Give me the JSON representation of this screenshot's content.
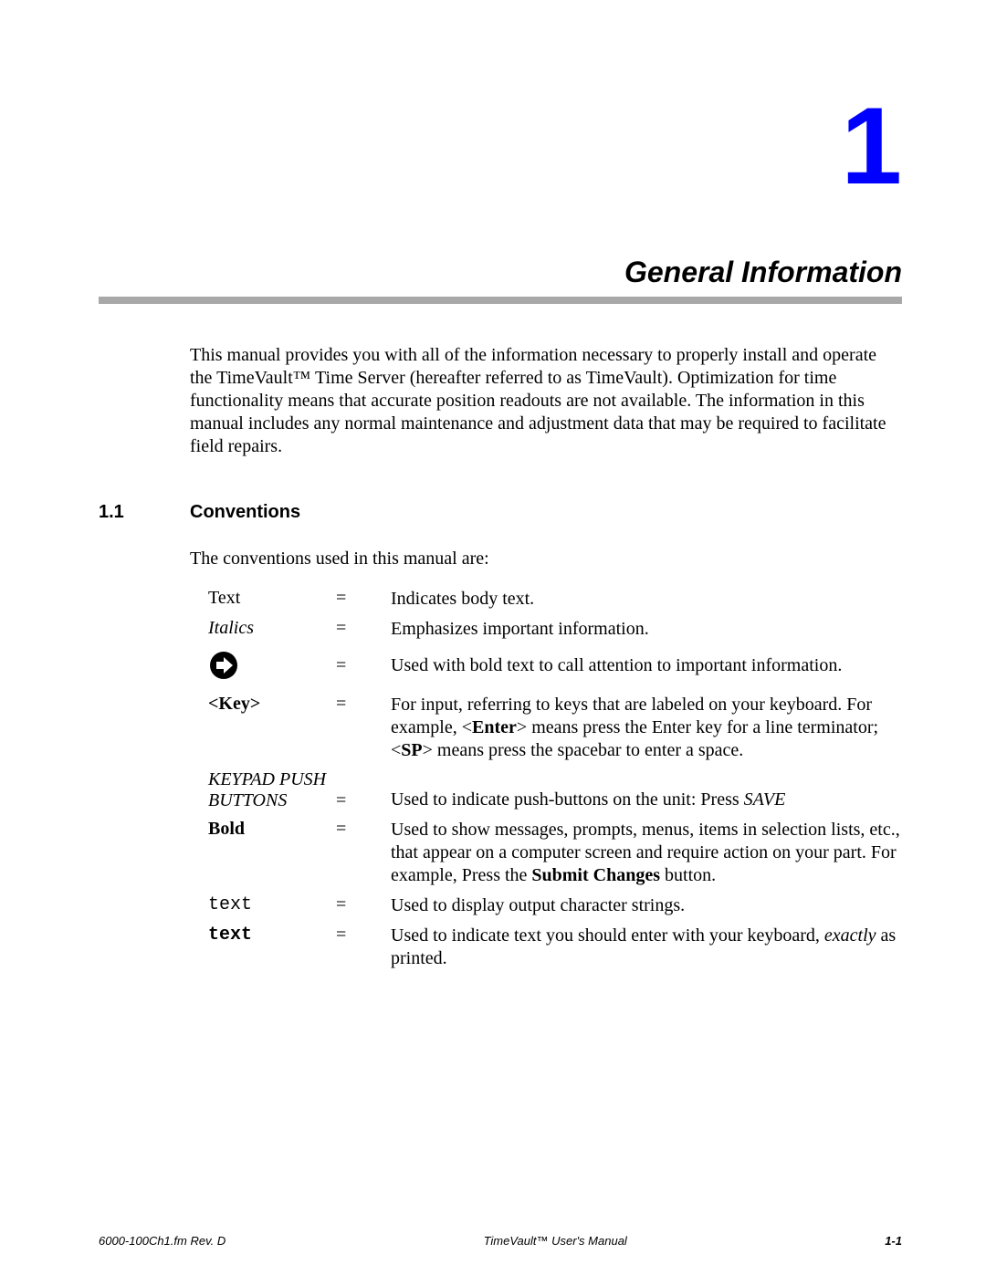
{
  "chapter": {
    "number": "1",
    "title": "General Information"
  },
  "intro": "This manual provides you with all of the information necessary to properly install and operate the TimeVault™ Time Server (hereafter referred to as TimeVault).  Optimization for time functionality means that accurate position readouts are not available.  The information in this manual includes any normal maintenance and adjustment data that may be required to facilitate field repairs.",
  "section": {
    "number": "1.1",
    "title": "Conventions",
    "lead": "The conventions used in this manual are:"
  },
  "conventions": {
    "r1": {
      "label": "Text",
      "eq": "=",
      "desc": "Indicates body text."
    },
    "r2": {
      "label": "Italics",
      "eq": "=",
      "desc": "Emphasizes important information."
    },
    "r3": {
      "eq": "=",
      "desc": "Used with bold text to call attention to important information."
    },
    "r4": {
      "label": "<Key>",
      "eq": "=",
      "d1": "For input, referring to keys that are labeled on your keyboard. For example, <",
      "d2": "Enter",
      "d3": "> means press the Enter key for a line terminator;  <",
      "d4": "SP",
      "d5": "> means press the spacebar to enter a space."
    },
    "r5": {
      "label1": "KEYPAD PUSH",
      "label2": "BUTTONS",
      "eq": "=",
      "d1": "Used to indicate push-buttons on the unit: Press ",
      "d2": "SAVE"
    },
    "r6": {
      "label": "Bold",
      "eq": "=",
      "d1": "Used to show messages, prompts, menus, items in selection lists, etc., that appear on a computer screen and require action on your part.  For example, Press the ",
      "d2": "Submit Changes",
      "d3": " button."
    },
    "r7": {
      "label": "text",
      "eq": "=",
      "desc": "Used to display output character strings."
    },
    "r8": {
      "label": "text",
      "eq": "=",
      "d1": "Used to indicate text you should enter with your keyboard, ",
      "d2": "exactly",
      "d3": " as printed."
    }
  },
  "footer": {
    "left": "6000-100Ch1.fm  Rev. D",
    "center": "TimeVault™ User's Manual",
    "right": "1-1"
  }
}
